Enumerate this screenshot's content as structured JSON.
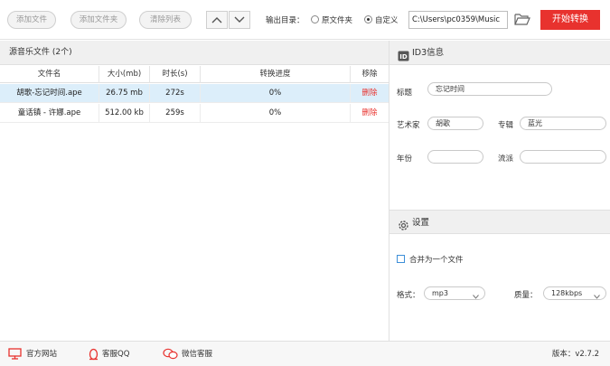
{
  "toolbar": {
    "add_file": "添加文件",
    "add_folder": "添加文件夹",
    "clear_list": "清除列表",
    "output_label": "输出目录：",
    "option_source": "原文件夹",
    "option_custom": "自定义",
    "output_path": "C:\\Users\\pc0359\\Music",
    "start_label": "开始转换"
  },
  "file_list": {
    "header": "源音乐文件 (2个)",
    "columns": [
      "文件名",
      "大小(mb)",
      "时长(s)",
      "转换进度",
      "移除"
    ],
    "rows": [
      {
        "name": "胡歌-忘记时间.ape",
        "size": "26.75 mb",
        "duration": "272s",
        "progress": "0%",
        "remove": "删除"
      },
      {
        "name": "童话镇 - 许娜.ape",
        "size": "512.00 kb",
        "duration": "259s",
        "progress": "0%",
        "remove": "删除"
      }
    ]
  },
  "id3": {
    "header": "ID3信息",
    "title_label": "标题",
    "title_value": "忘记时间",
    "artist_label": "艺术家",
    "artist_value": "胡歌",
    "album_label": "专辑",
    "album_value": "蓝光",
    "year_label": "年份",
    "year_value": "",
    "genre_label": "流派",
    "genre_value": ""
  },
  "settings": {
    "header": "设置",
    "merge_label": "合并为一个文件",
    "merge_checked": false,
    "format_label": "格式：",
    "format_value": "mp3",
    "quality_label": "质量：",
    "quality_value": "128kbps"
  },
  "footer": {
    "website": "官方网站",
    "qq": "客服QQ",
    "wechat": "微信客服",
    "version": "版本：v2.7.2"
  },
  "colors": {
    "accent": "#e8322e",
    "selected_row": "#dceefa",
    "checkbox_border": "#3d8fd8"
  },
  "icons": [
    "chevron-up-icon",
    "chevron-down-icon",
    "folder-open-icon",
    "id-icon",
    "gear-icon",
    "monitor-icon",
    "qq-penguin-icon",
    "wechat-icon"
  ]
}
